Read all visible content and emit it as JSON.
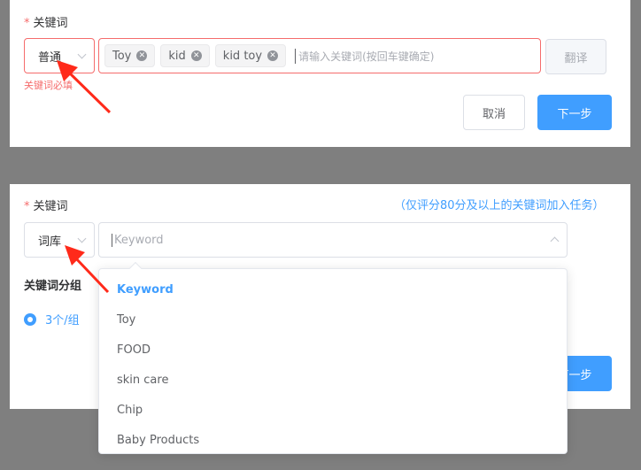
{
  "top_form": {
    "required_mark": "*",
    "keyword_label": "关键词",
    "mode_select_value": "普通",
    "tags": [
      {
        "label": "Toy"
      },
      {
        "label": "kid"
      },
      {
        "label": "kid toy"
      }
    ],
    "tag_input_placeholder": "请输入关键词(按回车键确定)",
    "translate_button": "翻译",
    "error_message": "关键词必填",
    "cancel_button": "取消",
    "next_button": "下一步"
  },
  "bottom_form": {
    "required_mark": "*",
    "keyword_label": "关键词",
    "hint": "（仅评分80分及以上的关键词加入任务）",
    "mode_select_value": "词库",
    "keyword_select_placeholder": "Keyword",
    "group_label": "关键词分组",
    "group_option": "3个/组",
    "next_button": "下一步"
  },
  "dropdown": {
    "items": [
      {
        "label": "Keyword",
        "selected": true
      },
      {
        "label": "Toy"
      },
      {
        "label": "FOOD"
      },
      {
        "label": "skin care"
      },
      {
        "label": "Chip"
      },
      {
        "label": "Baby Products"
      }
    ]
  },
  "colors": {
    "primary": "#409eff",
    "error": "#f56c6c",
    "annotation_arrow": "#ff2a1a",
    "backdrop": "#7f7f7f"
  },
  "icons": {
    "tag_close": "close-circle-icon",
    "select_arrow": "chevron-down-icon",
    "select_arrow_open": "chevron-up-icon",
    "annotation": "red-arrow-annotation"
  }
}
